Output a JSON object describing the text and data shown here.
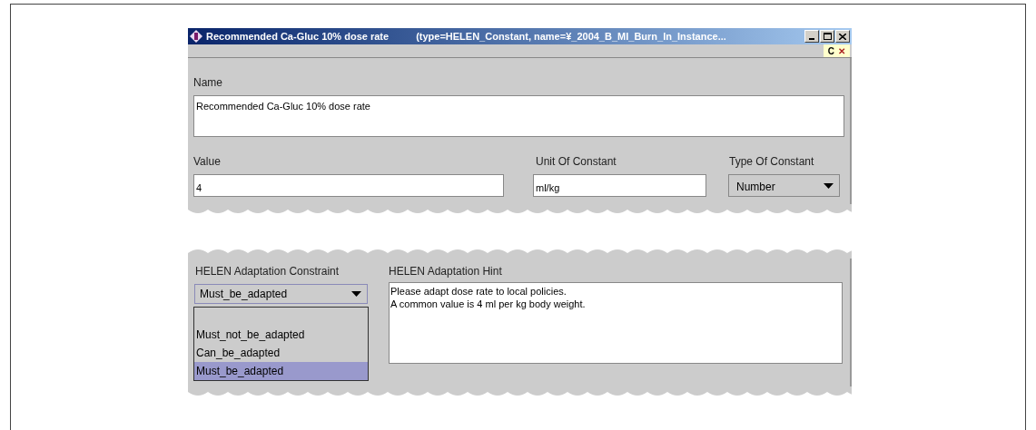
{
  "window": {
    "title": "Recommended Ca-Gluc 10% dose rate",
    "title_detail": "(type=HELEN_Constant, name=¥_2004_B_MI_Burn_In_Instance..."
  },
  "toolbar": {
    "badge": [
      "C",
      "✕"
    ]
  },
  "name_field": {
    "label": "Name",
    "value": "Recommended Ca-Gluc 10% dose rate"
  },
  "value_field": {
    "label": "Value",
    "value": "4"
  },
  "unit_field": {
    "label": "Unit Of Constant",
    "value": "ml/kg"
  },
  "type_field": {
    "label": "Type Of Constant",
    "value": "Number"
  },
  "constraint": {
    "label": "HELEN Adaptation Constraint",
    "value": "Must_be_adapted",
    "expanded": true,
    "options": [
      {
        "label": "Must_not_be_adapted",
        "selected": false
      },
      {
        "label": "Can_be_adapted",
        "selected": false
      },
      {
        "label": "Must_be_adapted",
        "selected": true
      }
    ]
  },
  "hint": {
    "label": "HELEN Adaptation Hint",
    "lines": [
      "Please adapt dose rate to local policies.",
      "A common value is 4 ml per kg body weight."
    ]
  }
}
